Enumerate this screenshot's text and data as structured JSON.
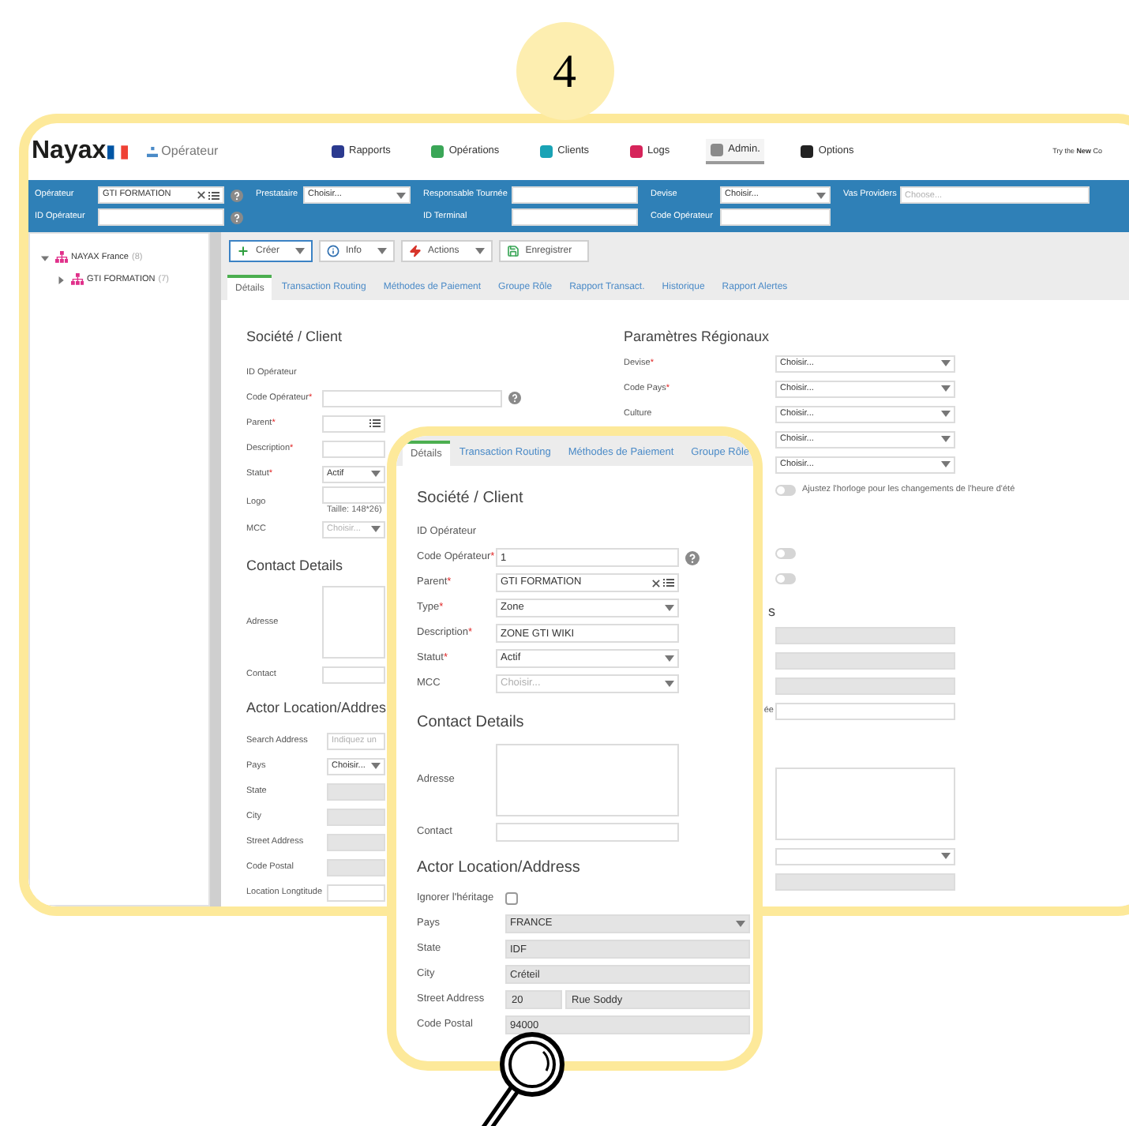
{
  "step_badge": "4",
  "screenshot": {
    "logo": "Nayax",
    "context_label": "Opérateur",
    "nav": [
      {
        "label": "Rapports",
        "color": "#2b3a8f",
        "selected": false
      },
      {
        "label": "Opérations",
        "color": "#3aa657",
        "selected": false
      },
      {
        "label": "Clients",
        "color": "#1aa3b5",
        "selected": false
      },
      {
        "label": "Logs",
        "color": "#d6245a",
        "selected": false
      },
      {
        "label": "Admin.",
        "color": "#8a8a8a",
        "selected": true
      },
      {
        "label": "Options",
        "color": "#222222",
        "selected": false
      }
    ],
    "promo": "Try the **New** Co",
    "filter_columns": [
      [
        {
          "label": "Opérateur",
          "kind": "lookup",
          "value": "GTI FORMATION",
          "help": true
        },
        {
          "label": "ID Opérateur",
          "kind": "text",
          "help": true
        }
      ],
      [
        {
          "label": "Prestataire",
          "kind": "select",
          "value": "Choisir..."
        }
      ],
      [
        {
          "label": "Responsable Tournée",
          "kind": "text"
        },
        {
          "label": "ID Terminal",
          "kind": "text"
        }
      ],
      [
        {
          "label": "Devise",
          "kind": "select",
          "value": "Choisir..."
        },
        {
          "label": "Code Opérateur",
          "kind": "text"
        }
      ],
      [
        {
          "label": "Vas Providers",
          "kind": "text",
          "placeholder": "Choose..."
        }
      ]
    ],
    "tree": [
      {
        "label": "NAYAX France",
        "count": "(8)",
        "expanded": true,
        "children": [
          {
            "label": "GTI FORMATION",
            "count": "(7)",
            "expanded": false
          }
        ]
      }
    ],
    "toolbar": [
      {
        "label": "Créer",
        "kind": "dropdown",
        "selected": true
      },
      {
        "label": "Info",
        "kind": "dropdown",
        "selected": false
      },
      {
        "label": "Actions",
        "kind": "dropdown",
        "selected": false
      },
      {
        "label": "Enregistrer",
        "kind": "plain",
        "selected": false
      }
    ],
    "tabs": [
      {
        "label": "Détails",
        "selected": true
      },
      {
        "label": "Transaction Routing",
        "selected": false
      },
      {
        "label": "Méthodes de Paiement",
        "selected": false
      },
      {
        "label": "Groupe Rôle",
        "selected": false
      },
      {
        "label": "Rapport Transact.",
        "selected": false
      },
      {
        "label": "Historique",
        "selected": false
      },
      {
        "label": "Rapport Alertes",
        "selected": false
      }
    ],
    "left_sections": [
      {
        "title": "Société / Client",
        "fields": [
          {
            "label": "ID Opérateur",
            "kind": "static"
          },
          {
            "label": "Code Opérateur",
            "required_mark": "*",
            "kind": "text",
            "disabled": false,
            "help": true
          },
          {
            "label": "Parent",
            "required_mark": "*",
            "kind": "lookup",
            "disabled": false
          },
          {
            "label": "Description",
            "required_mark": "*",
            "kind": "text",
            "disabled": false
          },
          {
            "label": "Statut",
            "required_mark": "*",
            "kind": "select",
            "value": "Actif",
            "disabled": false
          },
          {
            "label": "Logo",
            "kind": "image",
            "note": "Taille: 148*26)"
          },
          {
            "label": "MCC",
            "kind": "select",
            "placeholder": "Choisir...",
            "disabled": false
          }
        ]
      },
      {
        "title": "Contact Details",
        "fields": [
          {
            "label": "Adresse",
            "kind": "textarea"
          },
          {
            "label": "Contact",
            "kind": "text",
            "disabled": false
          }
        ]
      },
      {
        "title": "Actor Location/Addres",
        "fields": [
          {
            "label": "Search Address",
            "kind": "text",
            "placeholder": "Indiquez un",
            "disabled": false
          },
          {
            "label": "Pays",
            "kind": "select",
            "value": "Choisir...",
            "disabled": false
          },
          {
            "label": "State",
            "kind": "text",
            "disabled": true
          },
          {
            "label": "City",
            "kind": "text",
            "disabled": true
          },
          {
            "label": "Street Address",
            "kind": "text",
            "disabled": true
          },
          {
            "label": "Code Postal",
            "kind": "text",
            "disabled": true
          },
          {
            "label": "Location Longtitude",
            "kind": "text",
            "disabled": false
          }
        ]
      }
    ],
    "right_sections": [
      {
        "title": "Paramètres Régionaux",
        "fields": [
          {
            "label": "Devise",
            "required_mark": "*",
            "kind": "select",
            "value": "Choisir...",
            "disabled": false
          },
          {
            "label": "Code Pays",
            "required_mark": "*",
            "kind": "select",
            "value": "Choisir...",
            "disabled": false
          },
          {
            "label": "Culture",
            "kind": "select",
            "value": "Choisir...",
            "disabled": false
          },
          {
            "kind": "select",
            "value": "Choisir...",
            "disabled": false
          },
          {
            "kind": "select",
            "value": "Choisir...",
            "disabled": false
          },
          {
            "kind": "toggle",
            "on": false,
            "text": "Ajustez l'horloge pour les changements de l'heure d'été"
          }
        ]
      },
      {
        "fields": [
          {
            "kind": "toggle",
            "on": false
          },
          {
            "kind": "toggle",
            "on": false
          }
        ]
      },
      {
        "title_fragment": "s",
        "fields": [
          {
            "kind": "text",
            "disabled": true
          },
          {
            "kind": "text",
            "disabled": true
          },
          {
            "kind": "text",
            "disabled": true
          },
          {
            "label_fragment": "ée",
            "kind": "text",
            "disabled": false
          }
        ]
      },
      {
        "fields": [
          {
            "kind": "textarea"
          },
          {
            "kind": "select",
            "disabled": false
          },
          {
            "kind": "text",
            "disabled": true
          }
        ]
      }
    ]
  },
  "zoom_panel": {
    "tabs": [
      {
        "label": "Détails",
        "selected": true
      },
      {
        "label": "Transaction Routing",
        "selected": false
      },
      {
        "label": "Méthodes de Paiement",
        "selected": false
      },
      {
        "label": "Groupe Rôle",
        "selected": false
      }
    ],
    "sections": [
      {
        "title": "Société / Client",
        "fields": [
          {
            "label": "ID Opérateur",
            "kind": "static"
          },
          {
            "label": "Code Opérateur",
            "required_mark": "*",
            "kind": "text",
            "value": "1",
            "disabled": false,
            "help": true
          },
          {
            "label": "Parent",
            "required_mark": "*",
            "kind": "lookup",
            "value": "GTI FORMATION",
            "disabled": false
          },
          {
            "label": "Type",
            "required_mark": "*",
            "kind": "select",
            "value": "Zone",
            "disabled": false
          },
          {
            "label": "Description",
            "required_mark": "*",
            "kind": "text",
            "value": "ZONE GTI WIKI",
            "disabled": false
          },
          {
            "label": "Statut",
            "required_mark": "*",
            "kind": "select",
            "value": "Actif",
            "disabled": false
          },
          {
            "label": "MCC",
            "kind": "select",
            "placeholder": "Choisir...",
            "disabled": false
          }
        ]
      },
      {
        "title": "Contact Details",
        "fields": [
          {
            "label": "Adresse",
            "kind": "textarea"
          },
          {
            "label": "Contact",
            "kind": "text",
            "disabled": false
          }
        ]
      },
      {
        "title": "Actor Location/Address",
        "fields": [
          {
            "label": "Ignorer l'héritage",
            "kind": "checkbox",
            "checked": false
          },
          {
            "label": "Pays",
            "kind": "select",
            "value": "FRANCE",
            "disabled": true
          },
          {
            "label": "State",
            "kind": "text",
            "value": "IDF",
            "disabled": true
          },
          {
            "label": "City",
            "kind": "text",
            "value": "Créteil",
            "disabled": true
          },
          {
            "label": "Street Address",
            "kind": "split",
            "values": [
              "20",
              "Rue Soddy"
            ],
            "disabled": true
          },
          {
            "label": "Code Postal",
            "kind": "text",
            "value": "94000",
            "disabled": true
          }
        ]
      }
    ]
  }
}
